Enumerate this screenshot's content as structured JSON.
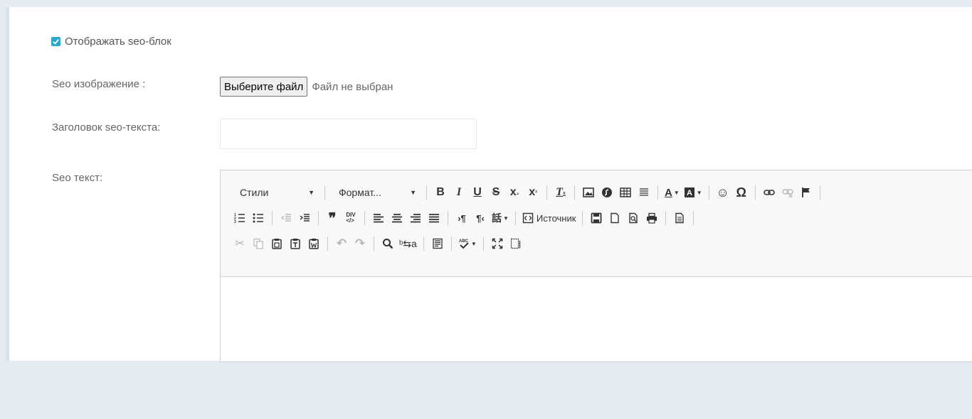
{
  "form": {
    "seo_block_checkbox_label": "Отображать seo-блок",
    "seo_image_label": "Seo изображение :",
    "file_button_label": "Выберите файл",
    "file_status": "Файл не выбран",
    "seo_title_label": "Заголовок seo-текста:",
    "seo_title_value": "",
    "seo_text_label": "Seo текст:"
  },
  "editor": {
    "styles_combo": "Стили",
    "format_combo": "Формат...",
    "source_label": "Источник",
    "row1_icons": [
      "bold-icon",
      "italic-icon",
      "underline-icon",
      "strike-icon",
      "subscript-icon",
      "superscript-icon",
      "remove-format-icon",
      "image-icon",
      "flash-icon",
      "table-icon",
      "horizontal-line-icon",
      "text-color-icon",
      "bg-color-icon",
      "smiley-icon",
      "special-char-icon",
      "link-icon",
      "unlink-icon",
      "anchor-icon"
    ],
    "row2_icons": [
      "numbered-list-icon",
      "bulleted-list-icon",
      "outdent-icon",
      "indent-icon",
      "blockquote-icon",
      "div-icon",
      "align-left-icon",
      "align-center-icon",
      "align-right-icon",
      "justify-icon",
      "ltr-icon",
      "rtl-icon",
      "language-icon",
      "source-icon",
      "save-icon",
      "new-page-icon",
      "preview-icon",
      "print-icon",
      "templates-icon"
    ],
    "row3_icons": [
      "cut-icon",
      "copy-icon",
      "paste-icon",
      "paste-text-icon",
      "paste-word-icon",
      "undo-icon",
      "redo-icon",
      "find-icon",
      "replace-icon",
      "select-all-icon",
      "spellcheck-icon",
      "maximize-icon",
      "show-blocks-icon"
    ]
  },
  "colors": {
    "accent": "#2aa7c9",
    "page_bg": "#e4ebf2"
  }
}
